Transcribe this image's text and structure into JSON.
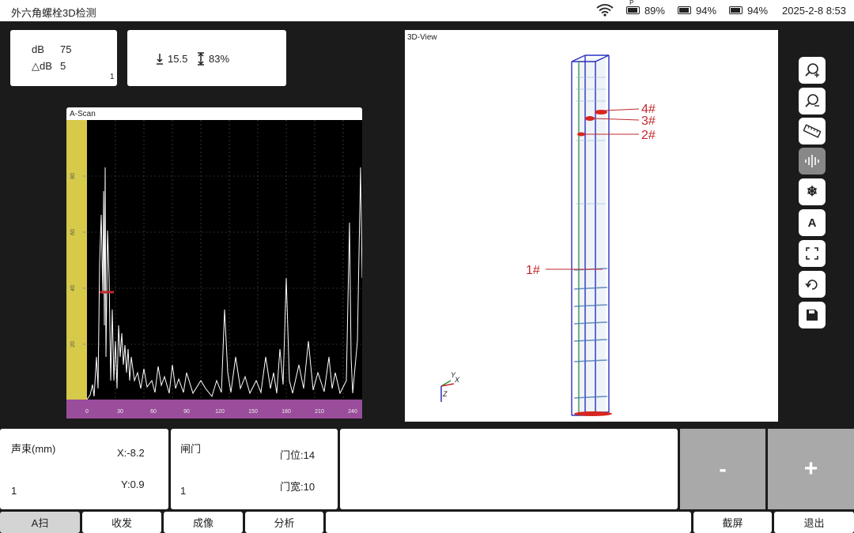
{
  "status": {
    "app_title": "外六角螺栓3D检测",
    "battery_p": "89%",
    "battery_2": "94%",
    "battery_3": "94%",
    "datetime": "2025-2-8 8:53"
  },
  "gain": {
    "db_label": "dB",
    "db_value": "75",
    "ddb_label": "△dB",
    "ddb_value": "5",
    "index": "1"
  },
  "measure": {
    "depth": "15.5",
    "amplitude": "83%"
  },
  "ascan": {
    "title": "A-Scan",
    "y_ticks": [
      "80",
      "60",
      "40",
      "20"
    ],
    "x_ticks": [
      "0",
      "30",
      "60",
      "90",
      "120",
      "150",
      "180",
      "210",
      "240"
    ]
  },
  "view3d": {
    "title": "3D-View",
    "markers": [
      "4#",
      "3#",
      "2#",
      "1#"
    ],
    "axes": {
      "y": "Y",
      "x": "X",
      "z": "Z"
    }
  },
  "toolbar": {
    "a_label": "A"
  },
  "beam": {
    "title": "声束(mm)",
    "x": "X:-8.2",
    "y": "Y:0.9",
    "value": "1"
  },
  "gate": {
    "title": "闸门",
    "pos": "门位:14",
    "width": "门宽:10",
    "value": "1"
  },
  "stepper": {
    "minus": "-",
    "plus": "+"
  },
  "tabs": {
    "ascan": "A扫",
    "txrx": "收发",
    "imaging": "成像",
    "analysis": "分析",
    "screenshot": "截屏",
    "exit": "退出"
  }
}
